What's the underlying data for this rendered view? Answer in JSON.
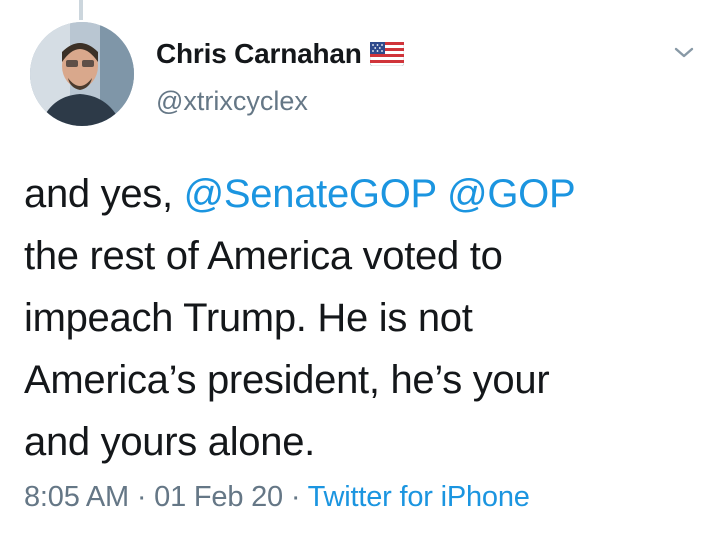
{
  "user": {
    "display_name": "Chris Carnahan",
    "handle": "@xtrixcyclex",
    "flag": "us-flag-icon"
  },
  "tweet": {
    "segments": [
      {
        "text": "and yes, "
      },
      {
        "text": "@SenateGOP",
        "mention": true
      },
      {
        "text": " "
      },
      {
        "text": "@GOP",
        "mention": true
      },
      {
        "text": "the rest of America voted to"
      },
      {
        "text": "impeach Trump. He is not"
      },
      {
        "text": "America’s president, he’s your"
      },
      {
        "text": "and yours alone."
      }
    ]
  },
  "meta": {
    "time": "8:05 AM",
    "separator": " · ",
    "date": "01 Feb 20",
    "source": "Twitter for iPhone"
  },
  "icons": {
    "menu": "chevron-down-icon"
  },
  "colors": {
    "text": "#14171a",
    "secondary": "#657786",
    "link": "#1b95e0"
  }
}
